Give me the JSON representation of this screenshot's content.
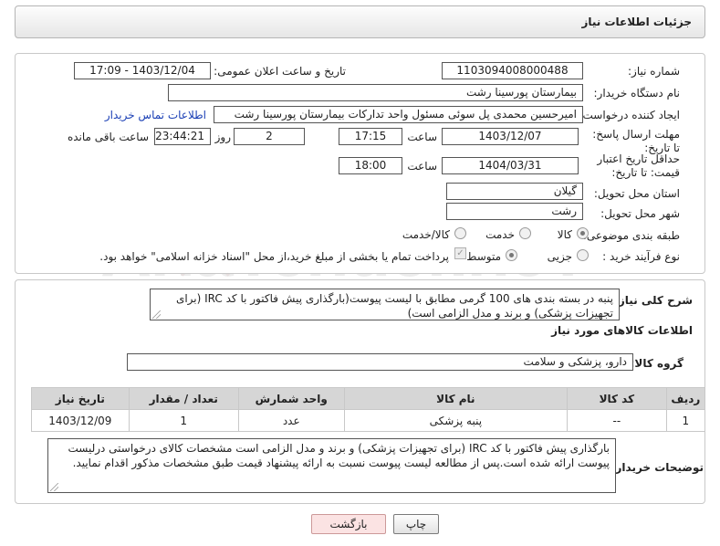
{
  "header": {
    "title": "جزئیات اطلاعات نیاز"
  },
  "form": {
    "need_number_label": "شماره نیاز:",
    "need_number": "1103094008000488",
    "announce_label": "تاریخ و ساعت اعلان عمومی:",
    "announce_value": "1403/12/04 - 17:09",
    "buyer_org_label": "نام دستگاه خریدار:",
    "buyer_org": "بیمارستان پورسینا رشت",
    "requester_label": "ایجاد کننده درخواست:",
    "requester": "امیرحسین محمدی پل سوئی مسئول واحد تدارکات بیمارستان پورسینا رشت",
    "contact_link": "اطلاعات تماس خریدار",
    "reply_deadline_label": "مهلت ارسال پاسخ: تا تاریخ:",
    "reply_date": "1403/12/07",
    "time_label": "ساعت",
    "reply_time": "17:15",
    "days_value": "2",
    "days_label": "روز و",
    "remaining_time": "23:44:21",
    "remaining_label": "ساعت باقی مانده",
    "validity_label": "حداقل تاریخ اعتبار قیمت: تا تاریخ:",
    "validity_date": "1404/03/31",
    "validity_time": "18:00",
    "province_label": "استان محل تحویل:",
    "province": "گیلان",
    "city_label": "شهر محل تحویل:",
    "city": "رشت",
    "category_label": "طبقه بندی موضوعی:",
    "category_options": [
      "کالا",
      "خدمت",
      "کالا/خدمت"
    ],
    "process_label": "نوع فرآیند خرید :",
    "process_options": [
      "جزیی",
      "متوسط"
    ],
    "payment_note": "پرداخت تمام یا بخشی از مبلغ خرید،از محل \"اسناد خزانه اسلامی\" خواهد بود."
  },
  "details": {
    "summary_label": "شرح کلی نیاز:",
    "summary": "پنبه در بسته بندی های 100 گرمی مطابق با لیست پیوست(بارگذاری پیش فاکتور با کد IRC (برای تجهیزات پزشکی) و برند و مدل الزامی است)",
    "items_heading": "اطلاعات کالاهای مورد نیاز",
    "group_label": "گروه کالا:",
    "group_value": "دارو، پزشکی و سلامت",
    "table_headers": [
      "ردیف",
      "کد کالا",
      "نام کالا",
      "واحد شمارش",
      "تعداد / مقدار",
      "تاریخ نیاز"
    ],
    "rows": [
      {
        "index": "1",
        "code": "--",
        "name": "پنبه پزشکی",
        "unit": "عدد",
        "qty": "1",
        "date": "1403/12/09"
      }
    ],
    "buyer_notes_label": "توضیحات خریدار:",
    "buyer_notes": "بارگذاری پیش فاکتور با کد IRC (برای تجهیزات پزشکی) و برند و مدل الزامی است مشخصات کالای درخواستی درلیست پیوست ارائه شده است.پس از مطالعه لیست پیوست نسبت به ارائه پیشنهاد قیمت طبق مشخصات مذکور اقدام نمایید."
  },
  "buttons": {
    "print": "چاپ",
    "back": "بازگشت"
  },
  "watermark": "AriaTender.neT"
}
